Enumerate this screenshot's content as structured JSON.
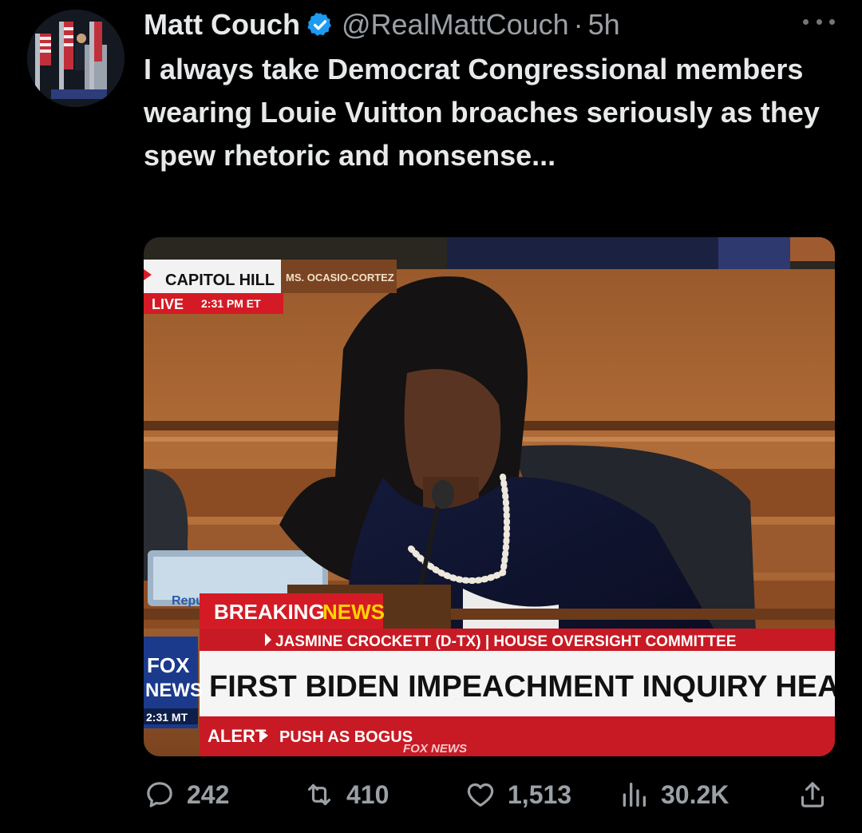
{
  "post": {
    "author_name": "Matt Couch",
    "handle": "@RealMattCouch",
    "separator": "·",
    "time": "5h",
    "text": "I always take Democrat Congressional members wearing Louie Vuitton broaches seriously as they spew rhetoric and nonsense..."
  },
  "icons": {
    "verified": "verified-badge-icon",
    "more": "more-options-icon",
    "reply": "reply-icon",
    "repost": "repost-icon",
    "like": "heart-icon",
    "views": "views-chart-icon",
    "share": "share-icon"
  },
  "media": {
    "location_label": "CAPITOL HILL",
    "live_label": "LIVE",
    "live_time": "2:31 PM ET",
    "nameplate": "MS. OCASIO-CORTEZ",
    "breaking_label": "BREAKING",
    "breaking_label2": "NEWS",
    "speaker_line": "JASMINE CROCKETT (D-TX) | HOUSE OVERSIGHT COMMITTEE",
    "headline": "FIRST BIDEN IMPEACHMENT INQUIRY HEARING UNDER",
    "network_top": "FOX",
    "network_bottom": "NEWS",
    "network_time": "2:31 MT",
    "alert_label": "ALERT",
    "ticker_text": "PUSH AS BOGUS",
    "ticker_network": "FOX NEWS",
    "rep_partial": "Repu"
  },
  "stats": {
    "replies": "242",
    "reposts": "410",
    "likes": "1,513",
    "views": "30.2K"
  },
  "colors": {
    "background": "#000000",
    "text": "#e7e9ea",
    "muted": "#71767b",
    "verified_blue": "#1d9bf0",
    "fox_red": "#d41b25"
  }
}
